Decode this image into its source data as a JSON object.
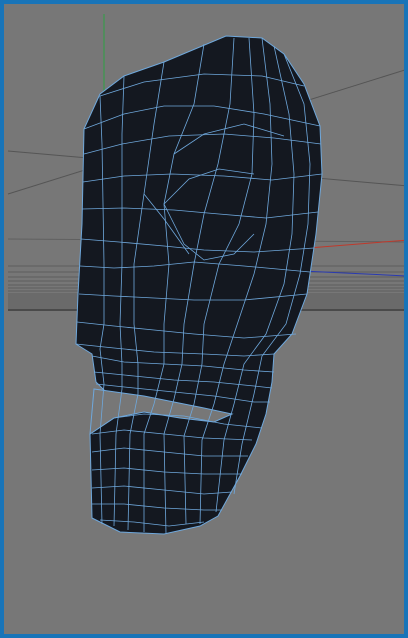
{
  "viewport": {
    "view": "perspective",
    "object": "head-mesh",
    "display_mode": "wireframe-on-shaded"
  },
  "colors": {
    "frame_border": "#1874b8",
    "background": "#777777",
    "grid_line": "#5a5a5a",
    "mesh_fill": "#141820",
    "mesh_wire": "#6fa8dc",
    "axis_x": "#c0392b",
    "axis_y": "#2ea043",
    "axis_z": "#2a3ab0"
  },
  "axes": [
    "x-axis",
    "y-axis",
    "z-axis"
  ]
}
